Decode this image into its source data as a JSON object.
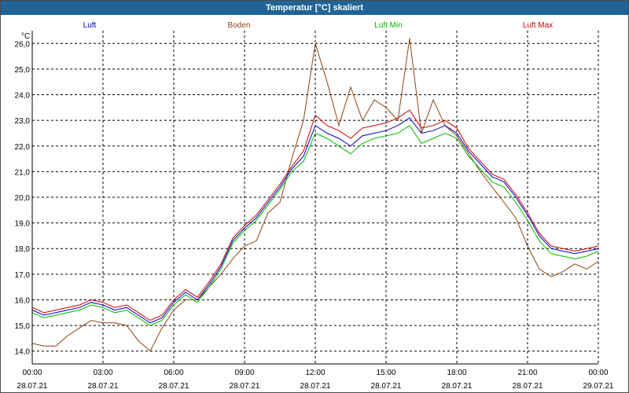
{
  "window": {
    "title": "Temperatur [°C] skaliert"
  },
  "chart_data": {
    "type": "line",
    "title": "Temperatur [°C] skaliert",
    "yunit": "°C",
    "ylim": [
      13.5,
      26.5
    ],
    "y_ticks": [
      "14,0",
      "15,0",
      "16,0",
      "17,0",
      "18,0",
      "19,0",
      "20,0",
      "21,0",
      "22,0",
      "23,0",
      "24,0",
      "25,0",
      "26,0"
    ],
    "x_range_hours": [
      0,
      24
    ],
    "x_ticks": [
      {
        "time": "00:00",
        "date": "28.07.21"
      },
      {
        "time": "03:00",
        "date": "28.07.21"
      },
      {
        "time": "06:00",
        "date": "28.07.21"
      },
      {
        "time": "09:00",
        "date": "28.07.21"
      },
      {
        "time": "12:00",
        "date": "28.07.21"
      },
      {
        "time": "15:00",
        "date": "28.07.21"
      },
      {
        "time": "18:00",
        "date": "28.07.21"
      },
      {
        "time": "21:00",
        "date": "28.07.21"
      },
      {
        "time": "00:00",
        "date": "29.07.21"
      }
    ],
    "grid": true,
    "legend_position": "top",
    "x": [
      0,
      0.5,
      1,
      1.5,
      2,
      2.5,
      3,
      3.5,
      4,
      4.5,
      5,
      5.5,
      6,
      6.5,
      7,
      7.5,
      8,
      8.5,
      9,
      9.5,
      10,
      10.5,
      11,
      11.5,
      12,
      12.5,
      13,
      13.5,
      14,
      14.5,
      15,
      15.5,
      16,
      16.5,
      17,
      17.5,
      18,
      18.5,
      19,
      19.5,
      20,
      20.5,
      21,
      21.5,
      22,
      22.5,
      23,
      23.5,
      24
    ],
    "series": [
      {
        "name": "Luft",
        "color": "#0000cc",
        "values": [
          15.6,
          15.4,
          15.5,
          15.6,
          15.7,
          15.9,
          15.8,
          15.6,
          15.7,
          15.4,
          15.1,
          15.3,
          15.9,
          16.3,
          16.0,
          16.6,
          17.3,
          18.3,
          18.8,
          19.2,
          19.8,
          20.4,
          21.1,
          21.6,
          22.8,
          22.5,
          22.3,
          22.0,
          22.4,
          22.5,
          22.6,
          22.8,
          23.1,
          22.5,
          22.6,
          22.8,
          22.5,
          21.8,
          21.3,
          20.8,
          20.6,
          20.0,
          19.3,
          18.5,
          18.0,
          17.9,
          17.8,
          17.9,
          18.0
        ]
      },
      {
        "name": "Boden",
        "color": "#8b4513",
        "values": [
          14.3,
          14.2,
          14.2,
          14.6,
          14.9,
          15.2,
          15.1,
          15.1,
          15.0,
          14.4,
          14.0,
          14.9,
          15.6,
          16.0,
          16.0,
          16.5,
          17.0,
          17.6,
          18.1,
          18.3,
          19.4,
          19.8,
          21.5,
          23.0,
          26.0,
          24.5,
          22.8,
          24.3,
          23.0,
          23.8,
          23.5,
          23.0,
          26.2,
          22.5,
          23.8,
          22.8,
          22.4,
          21.7,
          21.0,
          20.4,
          19.8,
          19.2,
          18.1,
          17.2,
          16.9,
          17.1,
          17.4,
          17.2,
          17.5
        ]
      },
      {
        "name": "Luft Min",
        "color": "#00bb00",
        "values": [
          15.5,
          15.3,
          15.4,
          15.5,
          15.6,
          15.8,
          15.7,
          15.5,
          15.6,
          15.3,
          15.0,
          15.2,
          15.8,
          16.2,
          15.9,
          16.5,
          17.2,
          18.2,
          18.7,
          19.1,
          19.7,
          20.3,
          21.0,
          21.4,
          22.5,
          22.3,
          22.0,
          21.7,
          22.1,
          22.3,
          22.4,
          22.5,
          22.8,
          22.1,
          22.3,
          22.5,
          22.3,
          21.6,
          21.1,
          20.6,
          20.4,
          19.8,
          19.1,
          18.3,
          17.8,
          17.7,
          17.6,
          17.7,
          17.9
        ]
      },
      {
        "name": "Luft Max",
        "color": "#cc0000",
        "values": [
          15.7,
          15.5,
          15.6,
          15.7,
          15.8,
          16.0,
          15.9,
          15.7,
          15.8,
          15.5,
          15.2,
          15.4,
          16.0,
          16.4,
          16.1,
          16.7,
          17.4,
          18.4,
          18.9,
          19.3,
          19.9,
          20.5,
          21.2,
          21.8,
          23.2,
          22.8,
          22.6,
          22.3,
          22.7,
          22.8,
          22.9,
          23.1,
          23.4,
          22.7,
          22.8,
          23.0,
          22.7,
          21.9,
          21.4,
          20.9,
          20.7,
          20.1,
          19.4,
          18.6,
          18.1,
          18.0,
          17.9,
          18.0,
          18.1
        ]
      }
    ]
  }
}
